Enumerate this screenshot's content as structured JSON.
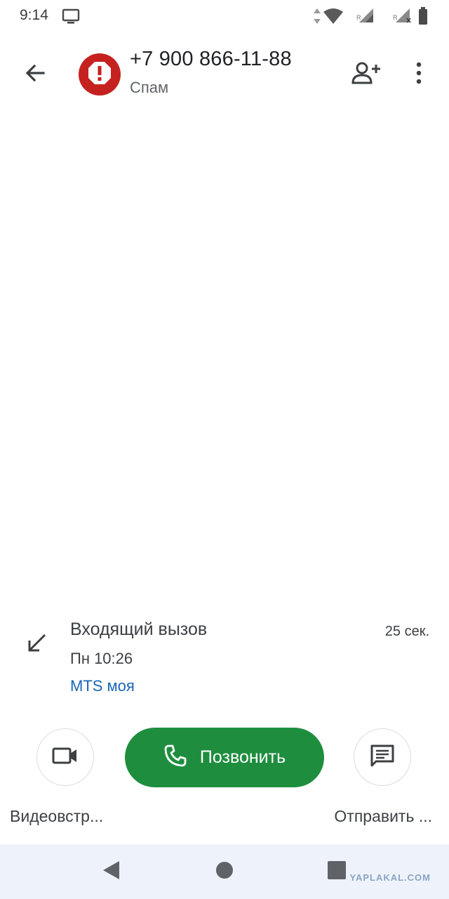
{
  "status_bar": {
    "time": "9:14",
    "icons": [
      "cast-icon",
      "data-arrows-icon",
      "wifi-icon",
      "signal-sim1-icon",
      "signal-sim2-icon",
      "battery-icon"
    ],
    "sim1_badge": "R",
    "sim2_badge": "R"
  },
  "header": {
    "back_icon": "arrow-back-icon",
    "avatar_icon": "spam-alert-icon",
    "phone_number": "+7 900 866-11-88",
    "label": "Спам",
    "add_contact_icon": "person-add-icon",
    "more_icon": "more-vert-icon"
  },
  "call_history": [
    {
      "icon": "incoming-call-icon",
      "type": "Входящий вызов",
      "time": "Пн 10:26",
      "sim": "MTS моя",
      "duration": "25 сек."
    }
  ],
  "actions": {
    "video_label": "Видеовстр...",
    "call_label": "Позвонить",
    "message_label": "Отправить ..."
  },
  "nav_bar": {
    "buttons": [
      "back-triangle-icon",
      "home-circle-icon",
      "recents-square-icon"
    ]
  },
  "watermark": "YAPLAKAL.COM",
  "colors": {
    "spam_red": "#c5221f",
    "call_green": "#1e8e3e",
    "sim_link_blue": "#1a65b4",
    "nav_bar_bg": "#eef3fb"
  }
}
